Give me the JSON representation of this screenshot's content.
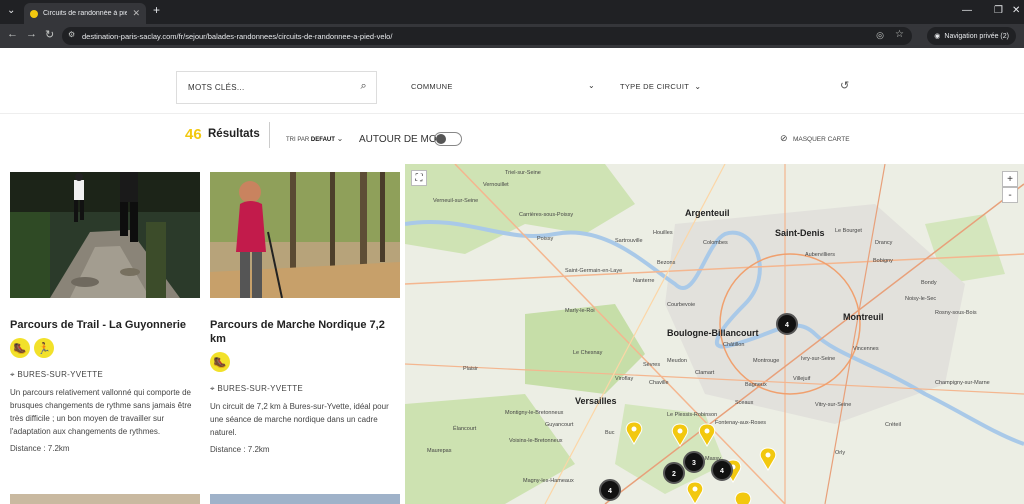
{
  "browser": {
    "tab_title": "Circuits de randonnée à pied e",
    "url": "destination-paris-saclay.com/fr/sejour/balades-randonnees/circuits-de-randonnee-a-pied-velo/",
    "private_label": "Navigation privée (2)"
  },
  "filters": {
    "keywords_placeholder": "MOTS CLÉS...",
    "commune_label": "COMMUNE",
    "type_label": "TYPE DE CIRCUIT"
  },
  "results": {
    "count": "46",
    "label": "Résultats",
    "sort_prefix": "TRI PAR",
    "sort_value": "DEFAUT",
    "nearby_label": "AUTOUR DE MOI",
    "hide_map_label": "MASQUER CARTE"
  },
  "cards": [
    {
      "title": "Parcours de Trail - La Guyonnerie",
      "location": "BURES-SUR-YVETTE",
      "description": "Un parcours relativement vallonné qui comporte de brusques changements de rythme sans jamais être très difficile ; un bon moyen de travailler sur l'adaptation aux changements de rythmes.",
      "distance": "Distance : 7.2km"
    },
    {
      "title": "Parcours de Marche Nordique 7,2 km",
      "location": "BURES-SUR-YVETTE",
      "description": "Un circuit de 7,2 km à Bures-sur-Yvette, idéal pour une séance de marche nordique dans un cadre naturel.",
      "distance": "Distance : 7.2km"
    }
  ],
  "map": {
    "labels": {
      "argenteuil": "Argenteuil",
      "saint_denis": "Saint-Denis",
      "montreuil": "Montreuil",
      "boulogne": "Boulogne-Billancourt",
      "versailles": "Versailles",
      "poissy": "Poissy",
      "vernouillet": "Vernouillet",
      "verneuil": "Verneuil-sur-Seine",
      "triel": "Triel-sur-Seine",
      "carrieres": "Carrières-sous-Poissy",
      "sgl": "Saint-Germain-en-Laye",
      "sartrouville": "Sartrouville",
      "houilles": "Houilles",
      "colombes": "Colombes",
      "nanterre": "Nanterre",
      "courbevoie": "Courbevoie",
      "marly": "Marly-le-Roi",
      "chesnay": "Le Chesnay",
      "vincennes": "Vincennes",
      "creteil": "Créteil",
      "villejuif": "Villejuif",
      "bobigny": "Bobigny",
      "aubervilliers": "Aubervilliers",
      "bondy": "Bondy",
      "montrouge": "Montrouge",
      "clamart": "Clamart",
      "sceaux": "Sceaux",
      "meudon": "Meudon",
      "bagneux": "Bagneux",
      "plessis": "Le Plessis-Robinson",
      "vitry": "Vitry-sur-Seine",
      "orly": "Orly",
      "massy": "Massy",
      "elancourt": "Élancourt",
      "plaisir": "Plaisir",
      "maurepas": "Maurepas",
      "guyancourt": "Guyancourt",
      "buc": "Buc",
      "drancy": "Drancy",
      "lebourget": "Le Bourget",
      "bezons": "Bezons",
      "sevres": "Sèvres",
      "chaville": "Chaville",
      "viroflay": "Viroflay",
      "fontenay": "Fontenay-aux-Roses",
      "chatillon": "Châtillon",
      "ivry": "Ivry-sur-Seine",
      "champigny": "Champigny-sur-Marne",
      "rosny": "Rosny-sous-Bois",
      "noisy": "Noisy-le-Sec",
      "magny": "Magny-les-Hameaux",
      "voisins": "Voisins-le-Bretonneux",
      "montigny": "Montigny-le-Bretonneux"
    },
    "clusters": [
      "4",
      "3",
      "2",
      "4",
      "4"
    ]
  }
}
